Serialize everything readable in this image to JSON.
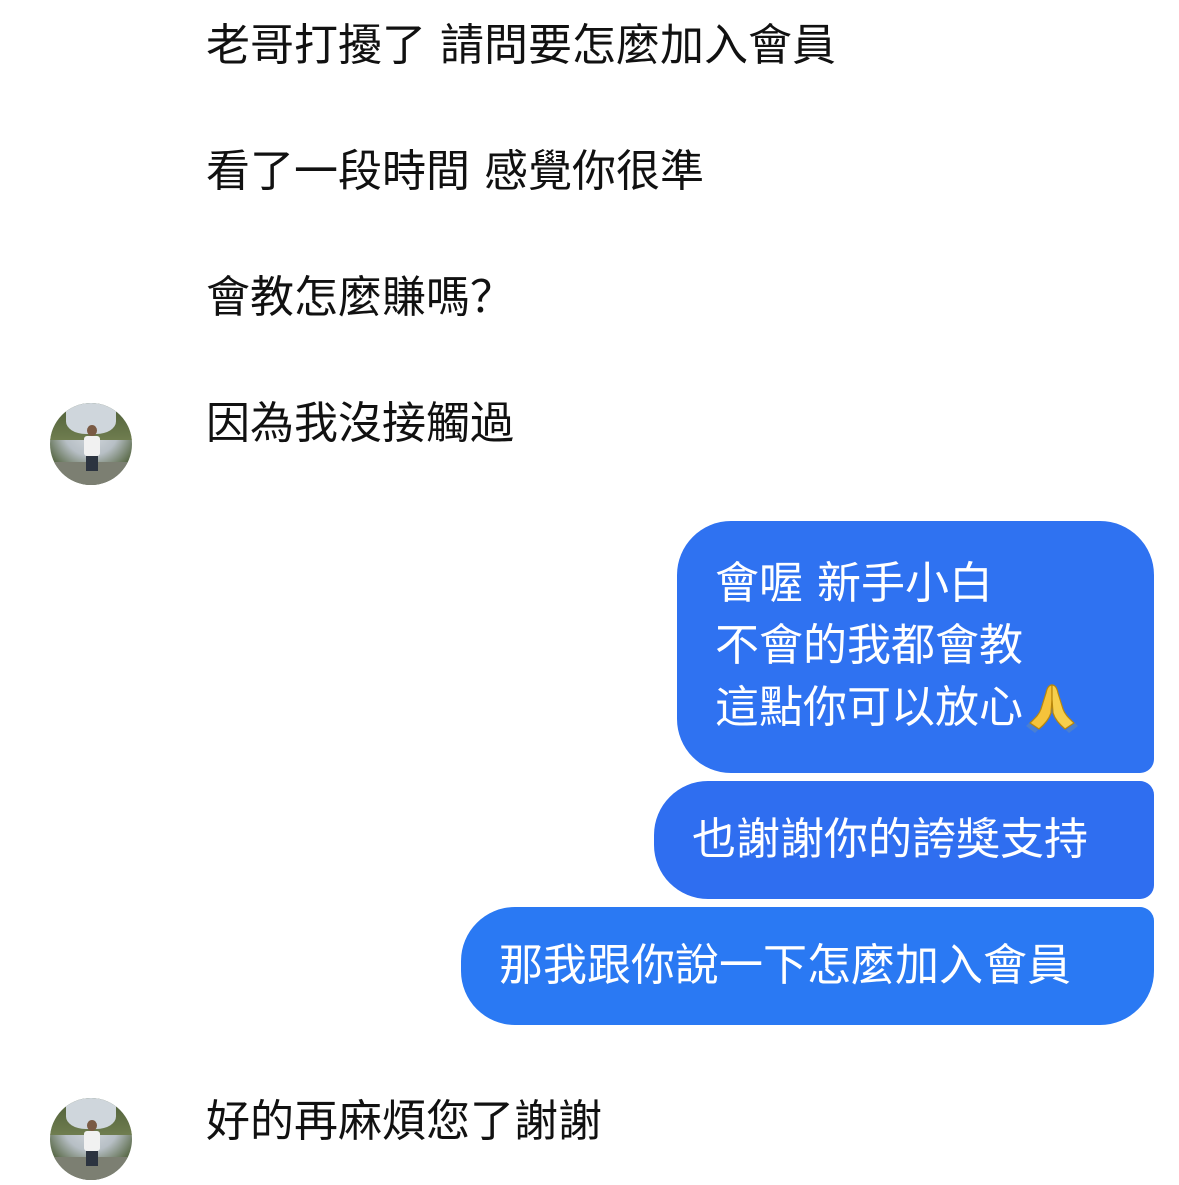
{
  "conversation": {
    "incoming_group_1": [
      "老哥打擾了 請問要怎麼加入會員",
      "看了一段時間 感覺你很準",
      "會教怎麼賺嗎？",
      "因為我沒接觸過"
    ],
    "outgoing": {
      "bubble_1_lines": [
        "會喔 新手小白",
        "不會的我都會教",
        "這點你可以放心"
      ],
      "bubble_1_emoji": "folded-hands-emoji",
      "bubble_2": "也謝謝你的誇獎支持",
      "bubble_3": "那我跟你說一下怎麼加入會員"
    },
    "incoming_group_2": [
      "好的再麻煩您了謝謝"
    ]
  },
  "colors": {
    "outgoing_bubble": "#2f72f1",
    "incoming_text": "#111111",
    "background": "#ffffff"
  }
}
